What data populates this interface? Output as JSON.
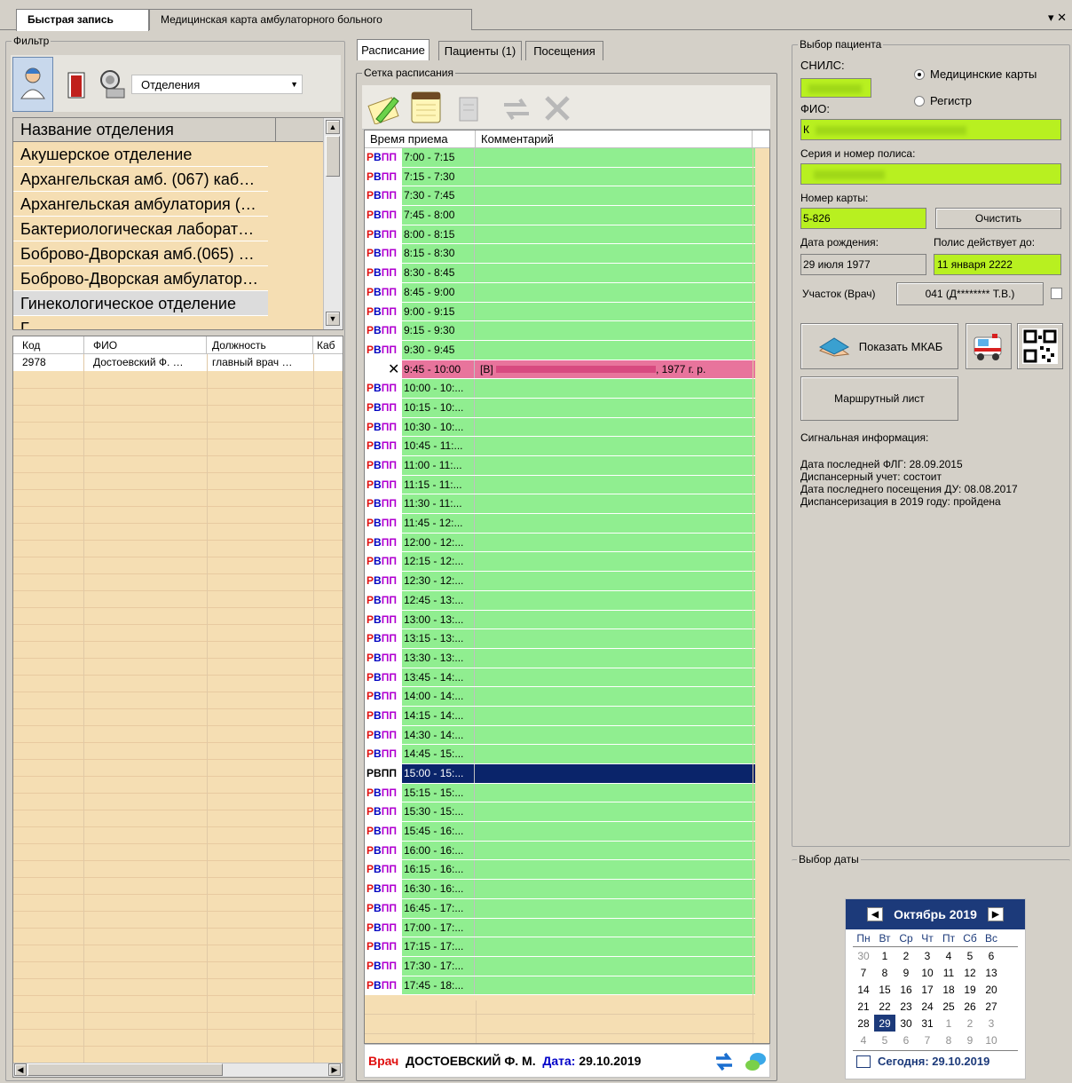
{
  "tabs": {
    "active": "Быстрая запись",
    "inactive": "Медицинская карта амбулаторного больного",
    "close": "▾ ✕"
  },
  "filter": {
    "label": "Фильтр",
    "dropdown_value": "Отделения",
    "dept_header": "Название отделения",
    "departments": [
      "Акушерское отделение",
      "Архангельская амб. (067) каб…",
      "Архангельская амбулатория (…",
      "Бактериологическая лаборат…",
      "Боброво-Дворская амб.(065) …",
      "Боброво-Дворская амбулатор…",
      "Гинекологическое отделение",
      "Г"
    ],
    "staff_headers": [
      "Код",
      "ФИО",
      "Должность",
      "Каб"
    ],
    "staff": [
      {
        "code": "2978",
        "fio": "Достоевский Ф. …",
        "pos": "главный врач …"
      }
    ]
  },
  "center": {
    "tabs": [
      "Расписание",
      "Пациенты (1)",
      "Посещения"
    ],
    "grid_label": "Сетка расписания",
    "col_time": "Время приема",
    "col_comment": "Комментарий",
    "code": "РВПП",
    "slots": [
      "7:00 - 7:15",
      "7:15 - 7:30",
      "7:30 - 7:45",
      "7:45 - 8:00",
      "8:00 - 8:15",
      "8:15 - 8:30",
      "8:30 - 8:45",
      "8:45 - 9:00",
      "9:00 - 9:15",
      "9:15 - 9:30",
      "9:30 - 9:45",
      "9:45 - 10:00",
      "10:00 - 10:...",
      "10:15 - 10:...",
      "10:30 - 10:...",
      "10:45 - 11:...",
      "11:00 - 11:...",
      "11:15 - 11:...",
      "11:30 - 11:...",
      "11:45 - 12:...",
      "12:00 - 12:...",
      "12:15 - 12:...",
      "12:30 - 12:...",
      "12:45 - 13:...",
      "13:00 - 13:...",
      "13:15 - 13:...",
      "13:30 - 13:...",
      "13:45 - 14:...",
      "14:00 - 14:...",
      "14:15 - 14:...",
      "14:30 - 14:...",
      "14:45 - 15:...",
      "15:00 - 15:...",
      "15:15 - 15:...",
      "15:30 - 15:...",
      "15:45 - 16:...",
      "16:00 - 16:...",
      "16:15 - 16:...",
      "16:30 - 16:...",
      "16:45 - 17:...",
      "17:00 - 17:...",
      "17:15 - 17:...",
      "17:30 - 17:...",
      "17:45 - 18:..."
    ],
    "booked_index": 11,
    "booked_comment_left": "[В] ",
    "booked_comment_right": ", 1977 г. р.",
    "selected_index": 32,
    "footer": {
      "doctor_label": "Врач",
      "doctor": "ДОСТОЕВСКИЙ Ф. М.",
      "date_label": "Дата:",
      "date": "29.10.2019"
    }
  },
  "patient": {
    "label": "Выбор пациента",
    "snils_label": "СНИЛС:",
    "radio1": "Медицинские карты",
    "radio2": "Регистр",
    "fio_label": "ФИО:",
    "fio_value": "К",
    "policy_label": "Серия и номер полиса:",
    "card_label": "Номер карты:",
    "card_value": "5-826",
    "clear_btn": "Очистить",
    "dob_label": "Дата рождения:",
    "dob_value": "29 июля 1977",
    "policy_until_label": "Полис действует до:",
    "policy_until_value": "11 января 2222",
    "district_label": "Участок (Врач)",
    "district_value": "041 (Д******** Т.В.)",
    "show_mkab": "Показать МКАБ",
    "route_sheet": "Маршрутный лист",
    "signal_label": "Сигнальная информация:",
    "signal_lines": [
      "Дата последней ФЛГ: 28.09.2015",
      "Диспансерный учет: состоит",
      "Дата последнего посещения ДУ: 08.08.2017",
      "Диспансеризация в 2019 году: пройдена"
    ]
  },
  "datepick": {
    "label": "Выбор даты",
    "month": "Октябрь 2019",
    "weekdays": [
      "Пн",
      "Вт",
      "Ср",
      "Чт",
      "Пт",
      "Сб",
      "Вс"
    ],
    "weeks": [
      [
        "30",
        "1",
        "2",
        "3",
        "4",
        "5",
        "6"
      ],
      [
        "7",
        "8",
        "9",
        "10",
        "11",
        "12",
        "13"
      ],
      [
        "14",
        "15",
        "16",
        "17",
        "18",
        "19",
        "20"
      ],
      [
        "21",
        "22",
        "23",
        "24",
        "25",
        "26",
        "27"
      ],
      [
        "28",
        "29",
        "30",
        "31",
        "1",
        "2",
        "3"
      ],
      [
        "4",
        "5",
        "6",
        "7",
        "8",
        "9",
        "10"
      ]
    ],
    "today": "Сегодня: 29.10.2019"
  }
}
